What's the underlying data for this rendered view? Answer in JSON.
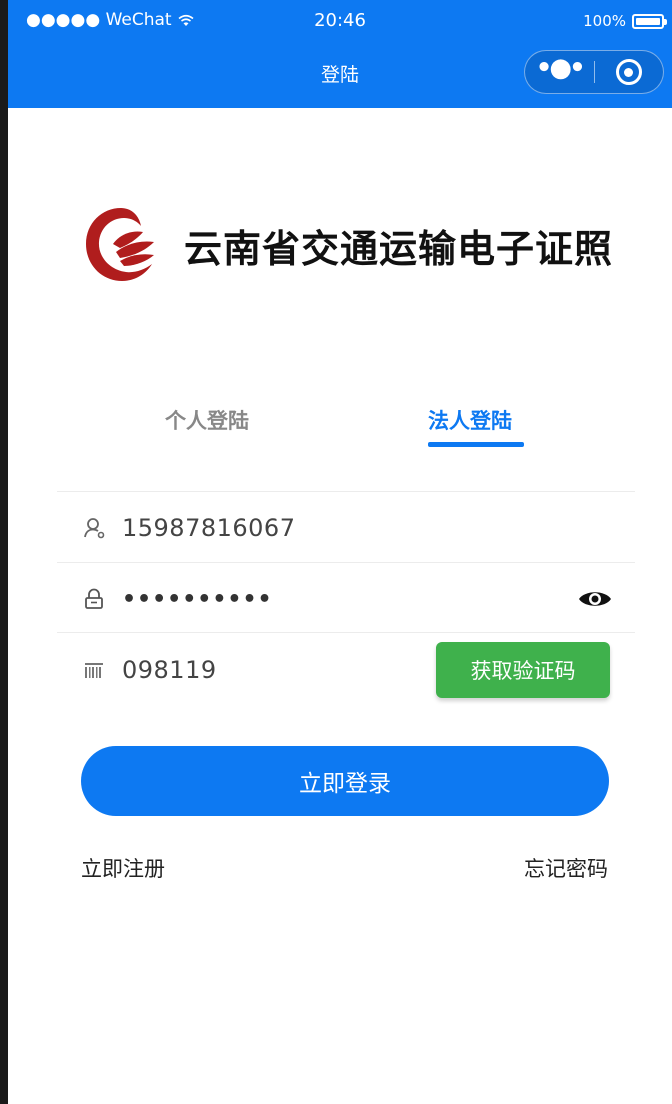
{
  "status_bar": {
    "carrier": "●●●●● WeChat",
    "time": "20:46",
    "battery": "100%"
  },
  "nav": {
    "title": "登陆",
    "more_icon": "more-dots-icon",
    "close_icon": "target-circle-icon"
  },
  "brand": {
    "name": "云南省交通运输电子证照",
    "logo_icon": "red-cloud-logo-icon"
  },
  "tabs": {
    "personal": "个人登陆",
    "legal": "法人登陆",
    "active": "legal"
  },
  "form": {
    "username": {
      "value": "15987816067",
      "icon": "user-icon"
    },
    "password": {
      "value": "••••••••••",
      "icon": "lock-icon",
      "toggle_icon": "eye-icon"
    },
    "code": {
      "value": "098119",
      "icon": "barcode-icon",
      "button_label": "获取验证码"
    }
  },
  "actions": {
    "login_label": "立即登录",
    "register_label": "立即注册",
    "forgot_label": "忘记密码"
  },
  "colors": {
    "primary": "#0d79f2",
    "success": "#3fb14c",
    "brand_red": "#b01d1d"
  }
}
